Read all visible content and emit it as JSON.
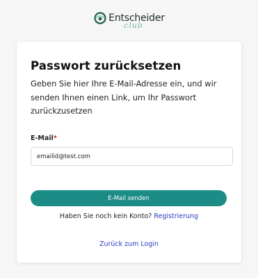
{
  "brand": {
    "name": "Entscheider",
    "sub": "club",
    "colors": {
      "mark": "#1e5f4f",
      "sub": "#7fb9a5"
    }
  },
  "form": {
    "title": "Passwort zurücksetzen",
    "description": "Geben Sie hier Ihre E-Mail-Adresse ein, und wir senden Ihnen einen Link, um Ihr Passwort zurückzusetzen",
    "email_label": "E-Mail",
    "required_marker": "*",
    "email_value": "emailid@test.com",
    "submit_label": "E-Mail senden",
    "no_account_text": "Haben Sie noch kein Konto?",
    "register_link": "Registrierung",
    "back_link": "Zurück zum Login"
  },
  "colors": {
    "accent": "#1c8c87",
    "link": "#2a3cc0",
    "required": "#d12020",
    "background": "#f6f6f6"
  }
}
